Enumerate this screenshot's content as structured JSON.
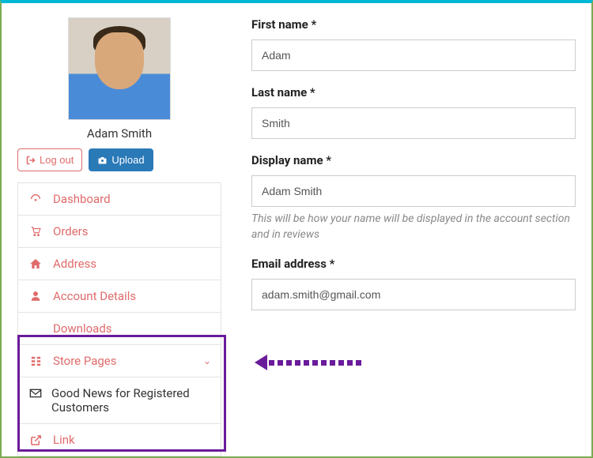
{
  "user": {
    "display_name": "Adam Smith"
  },
  "buttons": {
    "logout": "Log out",
    "upload": "Upload"
  },
  "nav": {
    "dashboard": "Dashboard",
    "orders": "Orders",
    "address": "Address",
    "account_details": "Account Details",
    "downloads": "Downloads",
    "store_pages": "Store Pages",
    "good_news": "Good News for Registered Customers",
    "link": "Link"
  },
  "form": {
    "first_name_label": "First name *",
    "first_name_value": "Adam",
    "last_name_label": "Last name *",
    "last_name_value": "Smith",
    "display_name_label": "Display name *",
    "display_name_value": "Adam Smith",
    "display_name_hint": "This will be how your name will be displayed in the account section and in reviews",
    "email_label": "Email address *",
    "email_value": "adam.smith@gmail.com"
  }
}
